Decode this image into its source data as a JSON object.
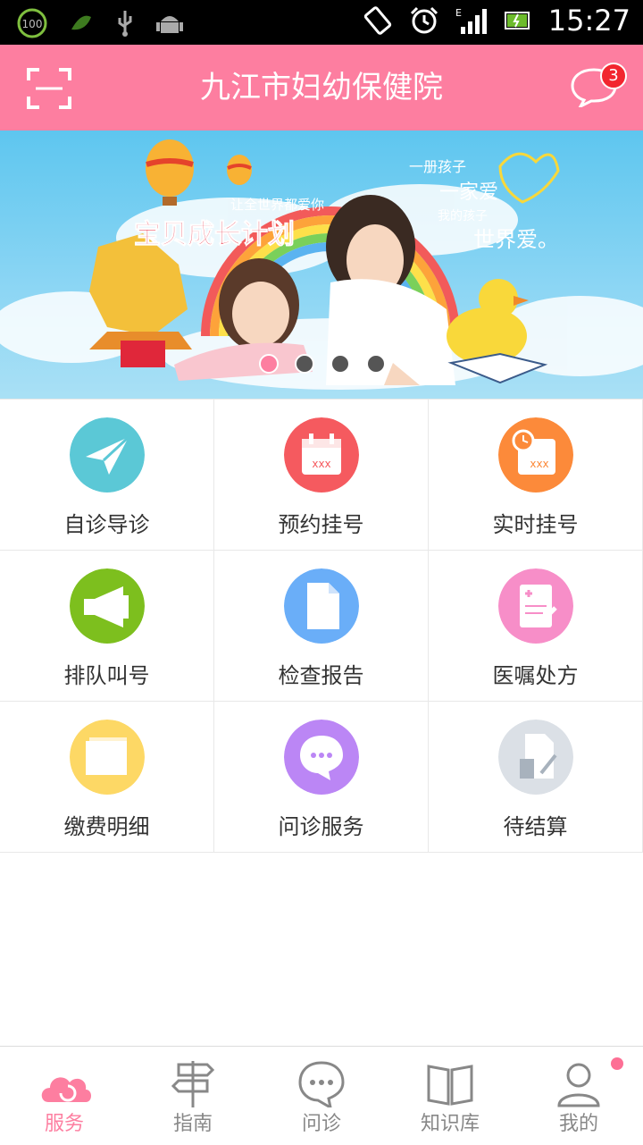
{
  "status_bar": {
    "time": "15:27",
    "battery_badge": "100"
  },
  "header": {
    "title": "九江市妇幼保健院",
    "message_count": "3"
  },
  "banner": {
    "slogan_small": "让全世界都爱你",
    "slogan_main": "宝贝成长计划",
    "hand_line1": "一册孩子",
    "hand_line2": "一家爱",
    "hand_line3": "我的孩子",
    "hand_line4": "世界爱。",
    "slide_count": 4,
    "active_slide": 1
  },
  "services": [
    {
      "label": "自诊导诊",
      "icon": "paper-plane-icon",
      "color": "#5bc8d6"
    },
    {
      "label": "预约挂号",
      "icon": "calendar-icon",
      "color": "#f55a5f"
    },
    {
      "label": "实时挂号",
      "icon": "calendar-clock-icon",
      "color": "#fc8a3a"
    },
    {
      "label": "排队叫号",
      "icon": "megaphone-icon",
      "color": "#7dbf1e"
    },
    {
      "label": "检查报告",
      "icon": "document-icon",
      "color": "#6aaef8"
    },
    {
      "label": "医嘱处方",
      "icon": "prescription-icon",
      "color": "#f78ec8"
    },
    {
      "label": "缴费明细",
      "icon": "folder-icon",
      "color": "#fdd865"
    },
    {
      "label": "问诊服务",
      "icon": "chat-bubble-icon",
      "color": "#bb86f5"
    },
    {
      "label": "待结算",
      "icon": "calculator-icon",
      "color": "#dbe0e6"
    }
  ],
  "tabs": [
    {
      "label": "服务",
      "icon": "cloud-refresh-icon",
      "active": true
    },
    {
      "label": "指南",
      "icon": "signpost-icon",
      "active": false
    },
    {
      "label": "问诊",
      "icon": "chat-icon",
      "active": false
    },
    {
      "label": "知识库",
      "icon": "book-icon",
      "active": false
    },
    {
      "label": "我的",
      "icon": "user-icon",
      "active": false
    }
  ]
}
